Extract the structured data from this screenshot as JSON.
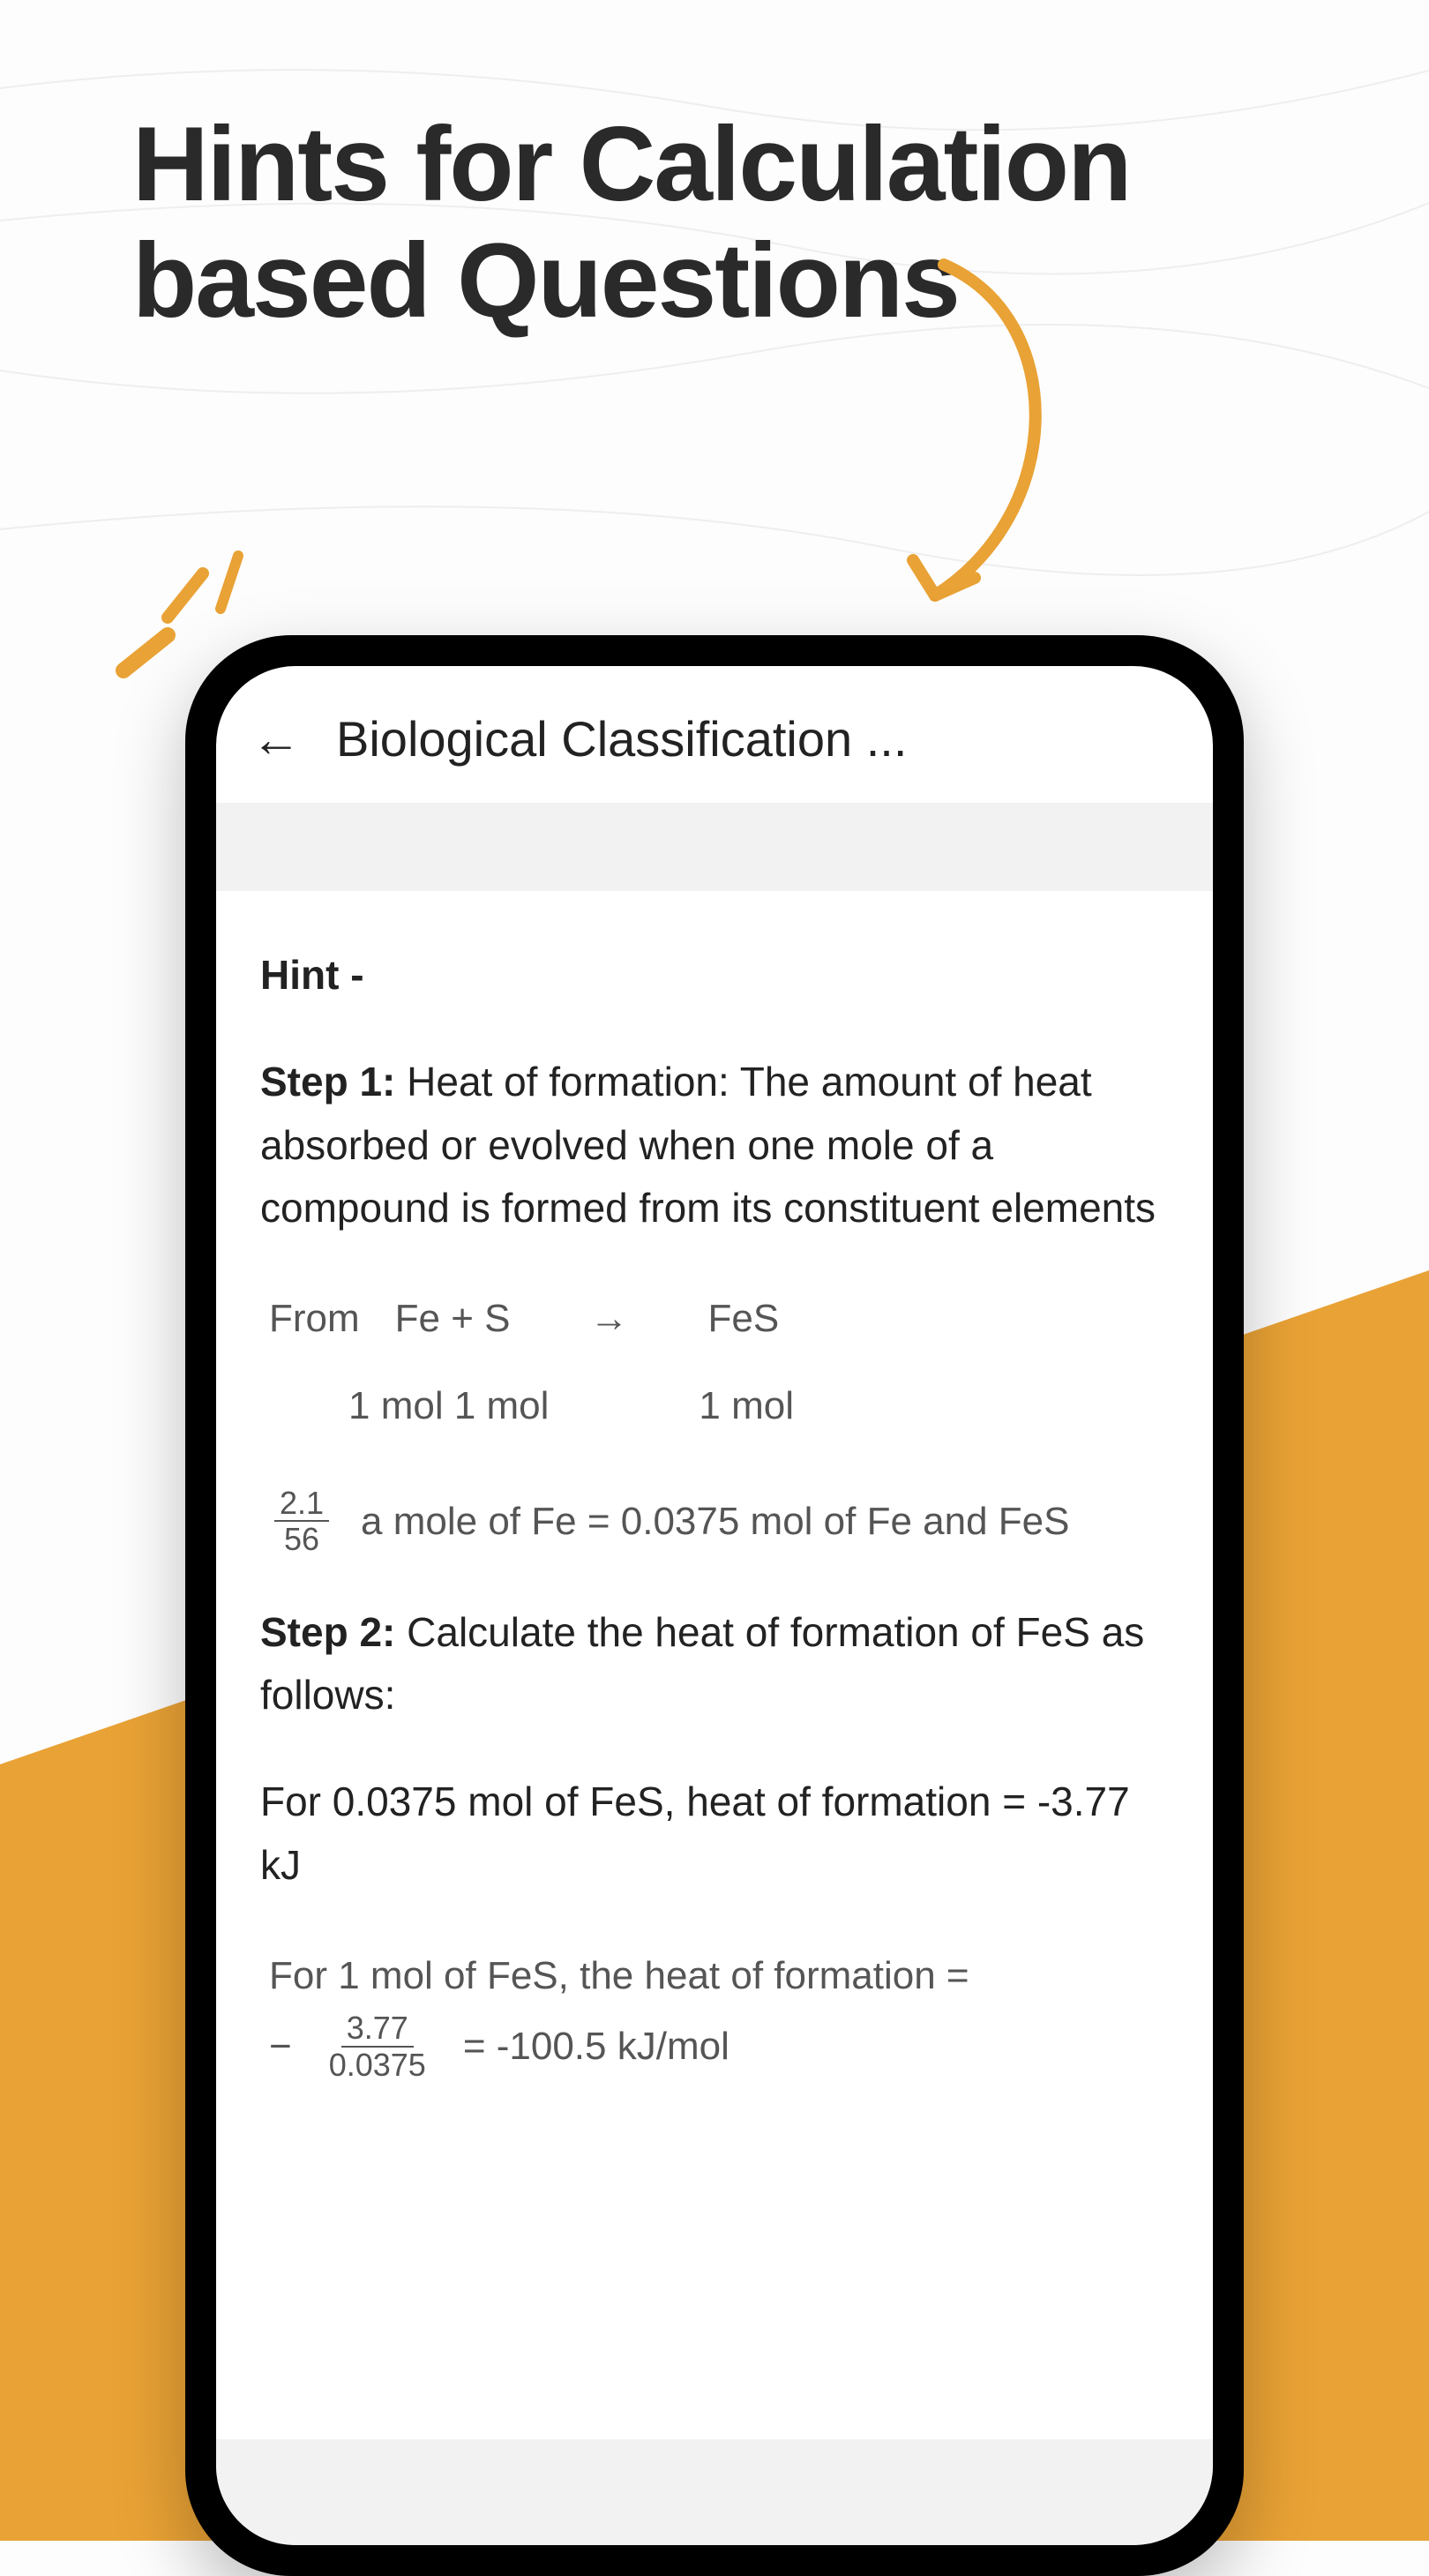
{
  "headline": {
    "line1": "Hints for Calculation",
    "line2": "based Questions"
  },
  "app": {
    "title": "Biological Classification ..."
  },
  "hint": {
    "label": "Hint -",
    "step1_label": "Step 1:",
    "step1_text": " Heat of formation: The amount of heat absorbed or evolved when one mole of a compound is formed from its constituent elements",
    "eq1_from": "From",
    "eq1_lhs": "Fe  +  S",
    "eq1_arrow": "→",
    "eq1_rhs": "FeS",
    "eq1_sub_lhs": "1 mol 1 mol",
    "eq1_sub_rhs": "1 mol",
    "eq2_frac_num": "2.1",
    "eq2_frac_den": "56",
    "eq2_text": " a mole of Fe =  0.0375 mol of Fe and FeS",
    "step2_label": "Step 2:",
    "step2_text": " Calculate the heat of formation of FeS as follows:",
    "calc1": "For 0.0375 mol of FeS, heat of formation = -3.77 kJ",
    "calc2_pre": "For 1 mol of FeS, the heat of formation =",
    "calc2_minus": "−",
    "calc2_frac_num": "3.77",
    "calc2_frac_den": "0.0375",
    "calc2_post": " = -100.5 kJ/mol"
  }
}
